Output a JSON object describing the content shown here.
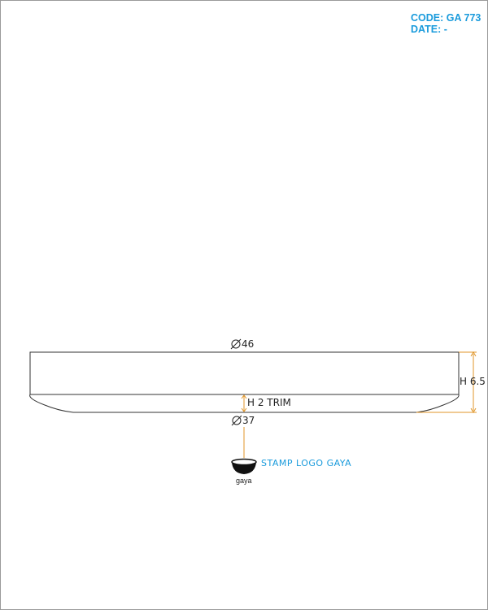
{
  "header": {
    "code": "CODE: GA 773",
    "date": "DATE: -"
  },
  "dimensions": {
    "top_diameter": "46",
    "bottom_diameter": "37",
    "height": "H 6.5",
    "trim": "H 2 TRIM"
  },
  "stamp": {
    "label": "STAMP LOGO GAYA",
    "logo_text": "gaya"
  },
  "colors": {
    "accent": "#1a9bdc",
    "dimension_line": "#e0962a",
    "outline": "#333333"
  }
}
